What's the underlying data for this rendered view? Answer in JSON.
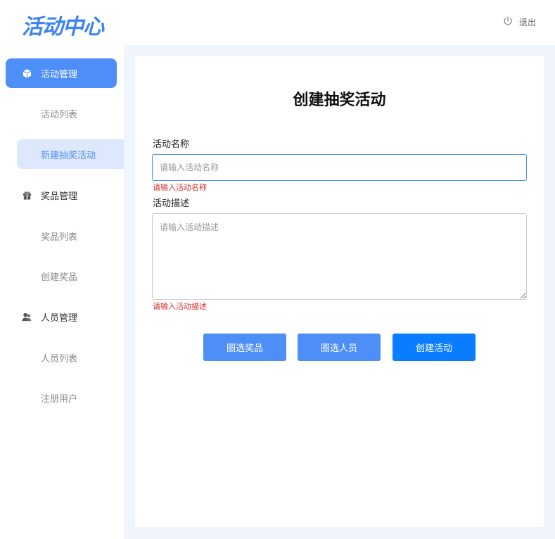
{
  "header": {
    "logo": "活动中心",
    "logout_label": "退出"
  },
  "sidebar": {
    "groups": [
      {
        "label": "活动管理",
        "icon": "box-icon",
        "items": [
          {
            "label": "活动列表"
          },
          {
            "label": "新建抽奖活动"
          }
        ]
      },
      {
        "label": "奖品管理",
        "icon": "gift-icon",
        "items": [
          {
            "label": "奖品列表"
          },
          {
            "label": "创建奖品"
          }
        ]
      },
      {
        "label": "人员管理",
        "icon": "users-icon",
        "items": [
          {
            "label": "人员列表"
          },
          {
            "label": "注册用户"
          }
        ]
      }
    ]
  },
  "form": {
    "title": "创建抽奖活动",
    "name_label": "活动名称",
    "name_placeholder": "请输入活动名称",
    "name_error": "请输入活动名称",
    "desc_label": "活动描述",
    "desc_placeholder": "请输入活动描述",
    "desc_error": "请输入活动描述",
    "buttons": {
      "select_prizes": "圈选奖品",
      "select_people": "圈选人员",
      "create": "创建活动"
    }
  },
  "colors": {
    "accent": "#4e8ef7",
    "primary_button": "#0a7cff",
    "error": "#d32f2f",
    "content_bg": "#f0f4fb"
  }
}
